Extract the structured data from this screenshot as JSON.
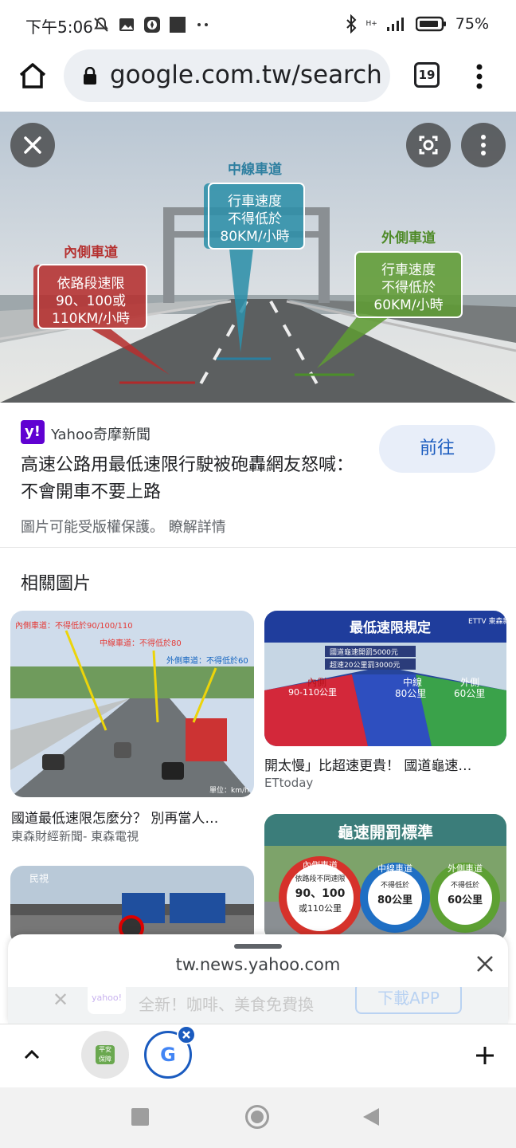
{
  "status_bar": {
    "time": "下午5:06",
    "battery": "75%",
    "net_label": "H+"
  },
  "url_bar": {
    "url": "google.com.tw/search?",
    "tab_count": "19"
  },
  "hero": {
    "label_inner": "內側車道",
    "label_middle": "中線車道",
    "label_outer": "外側車道",
    "bubble_inner": [
      "依路段速限",
      "90、100或",
      "110KM/小時"
    ],
    "bubble_middle": [
      "行車速度",
      "不得低於",
      "80KM/小時"
    ],
    "bubble_outer": [
      "行車速度",
      "不得低於",
      "60KM/小時"
    ]
  },
  "source": {
    "logo": "y!",
    "name": "Yahoo奇摩新聞",
    "title": "高速公路用最低速限行駛被砲轟網友怒喊：不會開車不要上路",
    "visit_label": "前往",
    "copyright": "圖片可能受版權保護。 瞭解詳情"
  },
  "related": {
    "heading": "相關圖片",
    "items": [
      {
        "caption": "國道最低速限怎麼分？ 別再當人…",
        "source": "東森財經新聞- 東森電視",
        "overlays": [
          "內側車道：不得低於90/100/110",
          "中線車道：不得低於80",
          "外側車道：不得低於60",
          "單位：km/h"
        ]
      },
      {
        "caption": "開太慢」比超速更貴！ 國道龜速…",
        "source": "ETtoday",
        "overlays": [
          "最低速限規定",
          "ETTV 東森新聞",
          "國道龜速開罰5000元",
          "超速20公里罰3000元",
          "內側",
          "90-110公里",
          "中線",
          "80公里",
          "外側",
          "60公里"
        ]
      },
      {
        "caption": "",
        "source": "",
        "overlays": [
          "龜速開罰標準",
          "內側車道",
          "依路段不同速限",
          "90、100",
          "或110公里",
          "中線車道",
          "不得低於",
          "80公里",
          "外側車道",
          "不得低於",
          "60公里"
        ]
      },
      {
        "caption": "",
        "source": "",
        "overlays": [
          "民視"
        ]
      }
    ]
  },
  "sheet": {
    "url": "tw.news.yahoo.com",
    "behind_logo": "yahoo!",
    "behind_text": "全新！咖啡、美食免費換",
    "behind_button": "下載APP"
  },
  "tabs": {
    "tab1_icon_text": "平安 保障",
    "tab2_letter": "G"
  }
}
